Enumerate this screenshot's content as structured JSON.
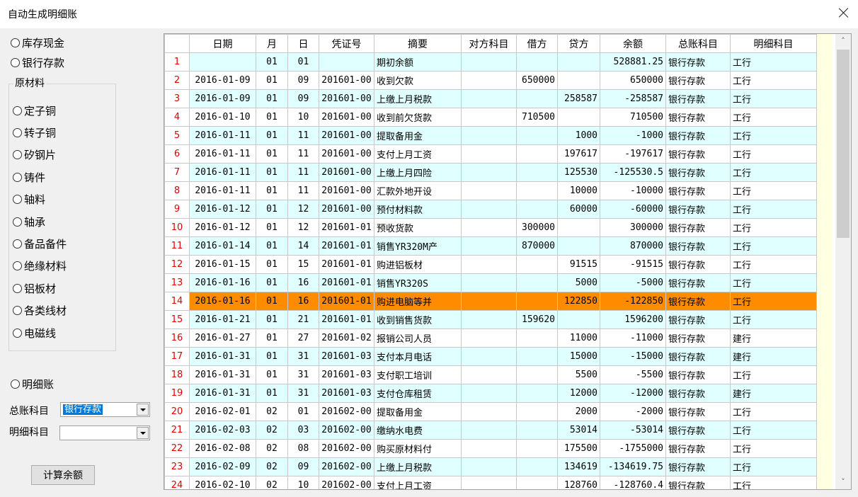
{
  "window": {
    "title": "自动生成明细账"
  },
  "left": {
    "radio_cash": "库存现金",
    "radio_bank": "银行存款",
    "group_label": "原材料",
    "materials": [
      "定子铜",
      "转子铜",
      "矽钢片",
      "铸件",
      "轴料",
      "轴承",
      "备品备件",
      "绝缘材料",
      "铝板材",
      "各类线材",
      "电磁线"
    ],
    "radio_detail": "明细账",
    "general_label": "总账科目",
    "general_value": "银行存款",
    "detail_label": "明细科目",
    "detail_value": "",
    "calc_button": "计算余额"
  },
  "grid": {
    "headers": [
      "",
      "日期",
      "月",
      "日",
      "凭证号",
      "摘要",
      "对方科目",
      "借方",
      "贷方",
      "余额",
      "总账科目",
      "明细科目"
    ],
    "selected_row": 14,
    "rows": [
      [
        "1",
        "",
        "01",
        "01",
        "",
        "期初余额",
        "",
        "",
        "",
        "528881.25",
        "银行存款",
        "工行"
      ],
      [
        "2",
        "2016-01-09",
        "01",
        "09",
        "201601-00",
        "收到欠款",
        "",
        "650000",
        "",
        "650000",
        "银行存款",
        "工行"
      ],
      [
        "3",
        "2016-01-09",
        "01",
        "09",
        "201601-00",
        "上缴上月税款",
        "",
        "",
        "258587",
        "-258587",
        "银行存款",
        "工行"
      ],
      [
        "4",
        "2016-01-10",
        "01",
        "10",
        "201601-00",
        "收到前欠货款",
        "",
        "710500",
        "",
        "710500",
        "银行存款",
        "工行"
      ],
      [
        "5",
        "2016-01-11",
        "01",
        "11",
        "201601-00",
        "提取备用金",
        "",
        "",
        "1000",
        "-1000",
        "银行存款",
        "工行"
      ],
      [
        "6",
        "2016-01-11",
        "01",
        "11",
        "201601-00",
        "支付上月工资",
        "",
        "",
        "197617",
        "-197617",
        "银行存款",
        "工行"
      ],
      [
        "7",
        "2016-01-11",
        "01",
        "11",
        "201601-00",
        "上缴上月四险",
        "",
        "",
        "125530",
        "-125530.5",
        "银行存款",
        "工行"
      ],
      [
        "8",
        "2016-01-11",
        "01",
        "11",
        "201601-00",
        "汇款外地开设",
        "",
        "",
        "10000",
        "-10000",
        "银行存款",
        "工行"
      ],
      [
        "9",
        "2016-01-12",
        "01",
        "12",
        "201601-00",
        "预付材料款",
        "",
        "",
        "60000",
        "-60000",
        "银行存款",
        "工行"
      ],
      [
        "10",
        "2016-01-12",
        "01",
        "12",
        "201601-01",
        "预收货款",
        "",
        "300000",
        "",
        "300000",
        "银行存款",
        "工行"
      ],
      [
        "11",
        "2016-01-14",
        "01",
        "14",
        "201601-01",
        "销售YR320M产",
        "",
        "870000",
        "",
        "870000",
        "银行存款",
        "工行"
      ],
      [
        "12",
        "2016-01-15",
        "01",
        "15",
        "201601-01",
        "购进铝板材",
        "",
        "",
        "91515",
        "-91515",
        "银行存款",
        "工行"
      ],
      [
        "13",
        "2016-01-16",
        "01",
        "16",
        "201601-01",
        "销售YR320S",
        "",
        "",
        "5000",
        "-5000",
        "银行存款",
        "工行"
      ],
      [
        "14",
        "2016-01-16",
        "01",
        "16",
        "201601-01",
        "购进电脑等并",
        "",
        "",
        "122850",
        "-122850",
        "银行存款",
        "工行"
      ],
      [
        "15",
        "2016-01-21",
        "01",
        "21",
        "201601-01",
        "收到销售货款",
        "",
        "159620",
        "",
        "1596200",
        "银行存款",
        "工行"
      ],
      [
        "16",
        "2016-01-27",
        "01",
        "27",
        "201601-02",
        "报销公司人员",
        "",
        "",
        "11000",
        "-11000",
        "银行存款",
        "建行"
      ],
      [
        "17",
        "2016-01-31",
        "01",
        "31",
        "201601-03",
        "支付本月电话",
        "",
        "",
        "15000",
        "-15000",
        "银行存款",
        "建行"
      ],
      [
        "18",
        "2016-01-31",
        "01",
        "31",
        "201601-03",
        "支付职工培训",
        "",
        "",
        "5500",
        "-5500",
        "银行存款",
        "工行"
      ],
      [
        "19",
        "2016-01-31",
        "01",
        "31",
        "201601-03",
        "支付仓库租赁",
        "",
        "",
        "12000",
        "-12000",
        "银行存款",
        "建行"
      ],
      [
        "20",
        "2016-02-01",
        "02",
        "01",
        "201602-00",
        "提取备用金",
        "",
        "",
        "2000",
        "-2000",
        "银行存款",
        "工行"
      ],
      [
        "21",
        "2016-02-03",
        "02",
        "03",
        "201602-00",
        "缴纳水电费",
        "",
        "",
        "53014",
        "-53014",
        "银行存款",
        "工行"
      ],
      [
        "22",
        "2016-02-08",
        "02",
        "08",
        "201602-00",
        "购买原材料付",
        "",
        "",
        "175500",
        "-1755000",
        "银行存款",
        "工行"
      ],
      [
        "23",
        "2016-02-09",
        "02",
        "09",
        "201602-00",
        "上缴上月税款",
        "",
        "",
        "134619",
        "-134619.75",
        "银行存款",
        "工行"
      ],
      [
        "24",
        "2016-02-10",
        "02",
        "10",
        "201602-00",
        "支付上月工资",
        "",
        "",
        "128760",
        "-128760.4",
        "银行存款",
        "工行"
      ]
    ]
  },
  "colors": {
    "selected": "#ff8c00",
    "alt_row": "#e0ffff",
    "row_number": "#e00000"
  }
}
